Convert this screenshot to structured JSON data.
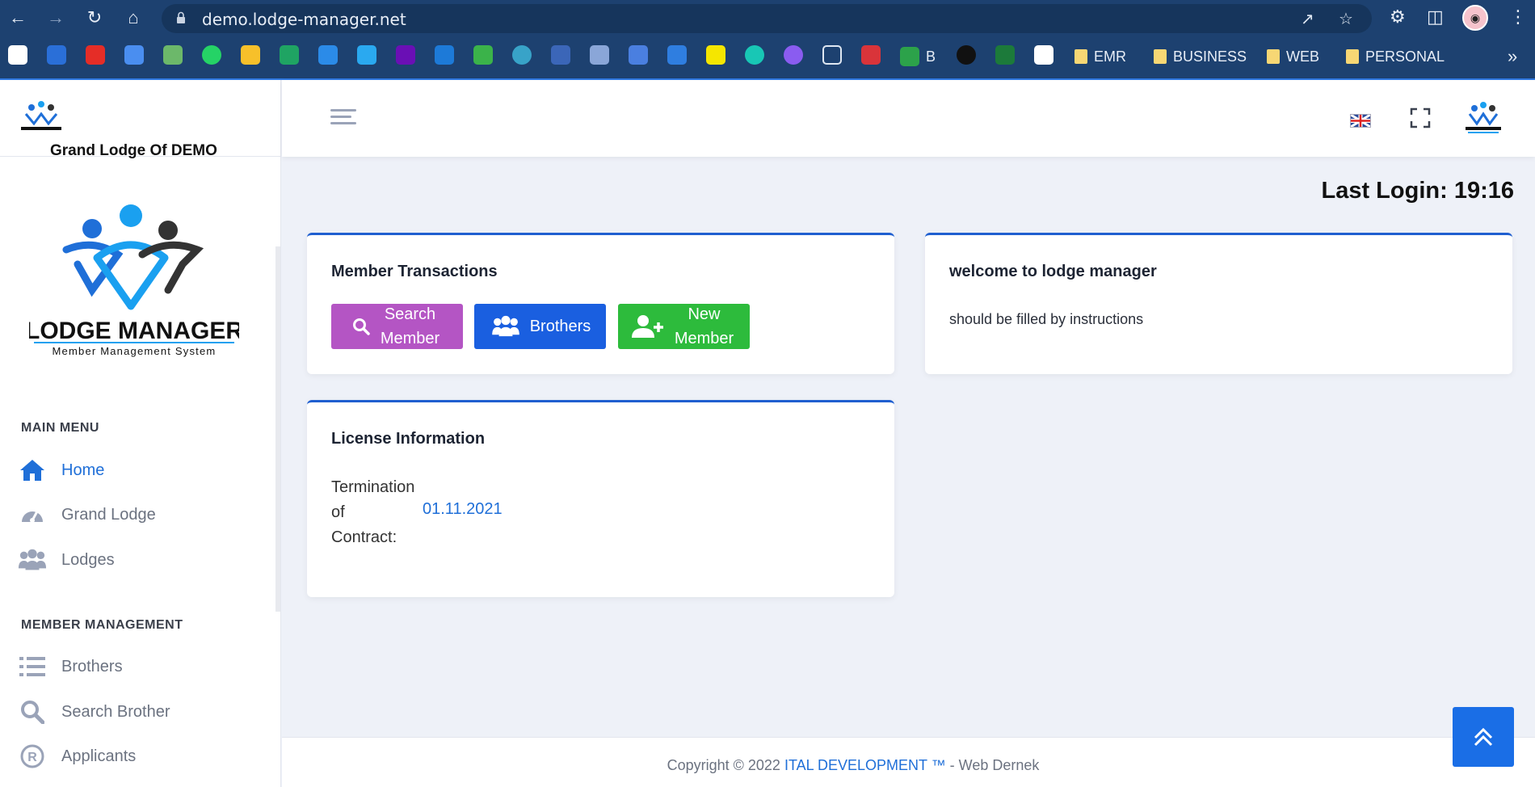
{
  "browser": {
    "url": "demo.lodge-manager.net",
    "bookmarks_text": [
      {
        "label": "B"
      },
      {
        "label": "EMR"
      },
      {
        "label": "BUSINESS"
      },
      {
        "label": "WEB"
      },
      {
        "label": "PERSONAL"
      }
    ],
    "overflow": "»"
  },
  "sidebar": {
    "org_title": "Grand Lodge Of DEMO",
    "logo_text": "LODGE MANAGER",
    "logo_subtext": "Member Management System",
    "main_menu_heading": "MAIN MENU",
    "main_menu": [
      {
        "label": "Home",
        "icon": "home-icon",
        "active": true
      },
      {
        "label": "Grand Lodge",
        "icon": "dashboard-gauge-icon"
      },
      {
        "label": "Lodges",
        "icon": "users-group-icon"
      }
    ],
    "member_heading": "MEMBER MANAGEMENT",
    "member_menu": [
      {
        "label": "Brothers",
        "icon": "list-icon"
      },
      {
        "label": "Search Brother",
        "icon": "search-icon"
      },
      {
        "label": "Applicants",
        "icon": "registered-icon"
      }
    ]
  },
  "content": {
    "last_login": "Last Login: 19:16",
    "member_transactions": {
      "title": "Member Transactions",
      "buttons": [
        {
          "label": "Search Member",
          "color": "#b455c4"
        },
        {
          "label": "Brothers",
          "color": "#1a5fe0"
        },
        {
          "label": "New Member",
          "color": "#2dbb3c"
        }
      ]
    },
    "welcome": {
      "title": "welcome to lodge manager",
      "text": "should be filled by instructions"
    },
    "license": {
      "title": "License Information",
      "label": "Termination of Contract:",
      "value": "01.11.2021"
    }
  },
  "footer": {
    "prefix": "Copyright © 2022 ",
    "link": "ITAL DEVELOPMENT ™",
    "suffix": " - Web Dernek"
  }
}
